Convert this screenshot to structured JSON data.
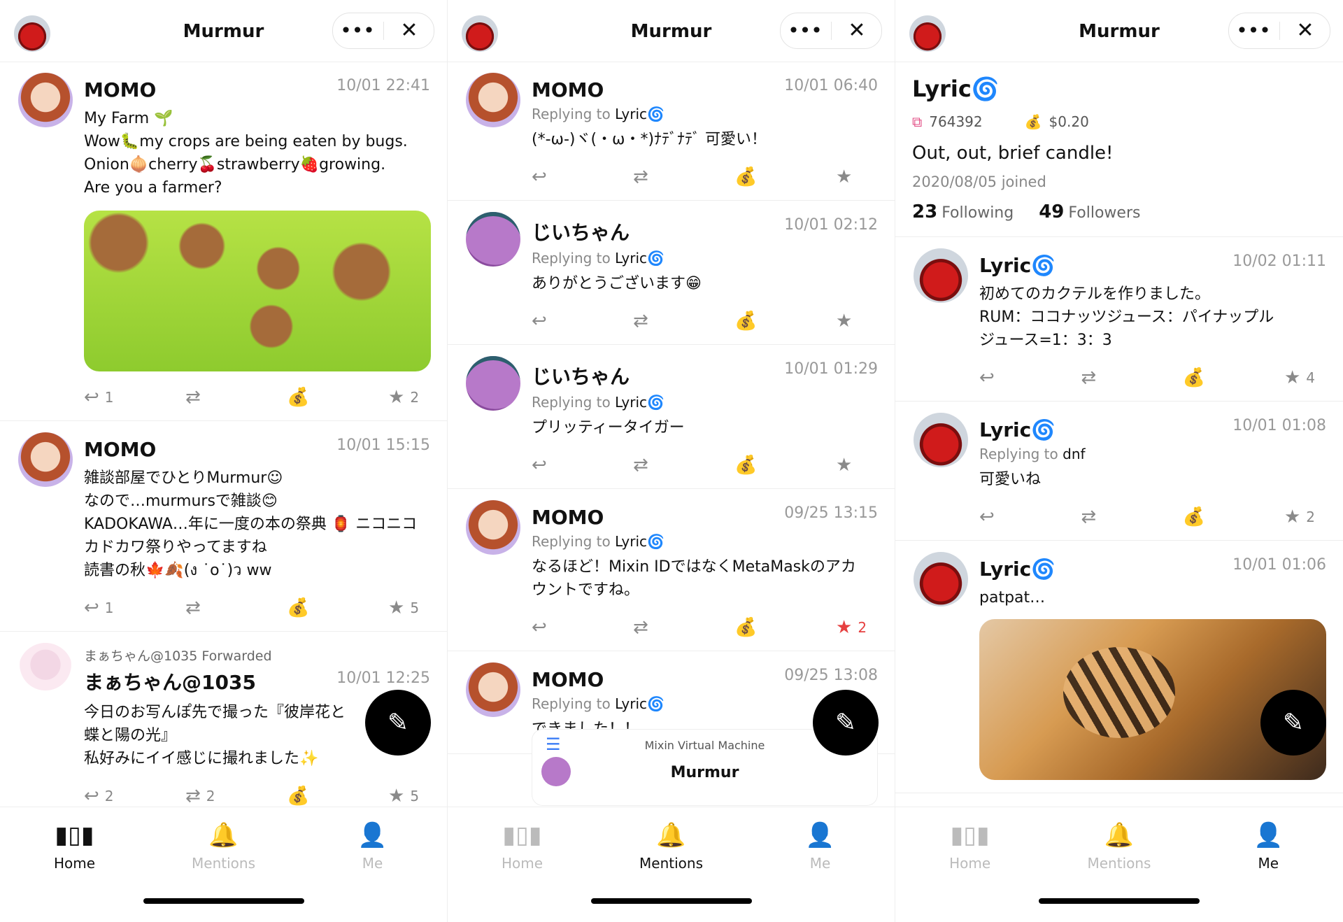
{
  "app": {
    "title": "Murmur",
    "more_icon": "•••",
    "close_icon": "✕",
    "nav": {
      "home": "Home",
      "mentions": "Mentions",
      "me": "Me"
    }
  },
  "home_feed": {
    "posts": [
      {
        "author": "MOMO",
        "time": "10/01 22:41",
        "text": "My Farm 🌱\nWow🐛my crops are being eaten by bugs.\nOnion🧅cherry🍒strawberry🍓growing.\nAre you a farmer?",
        "reply_count": "1",
        "repost_count": "",
        "star_count": "2"
      },
      {
        "author": "MOMO",
        "time": "10/01 15:15",
        "text": "雑談部屋でひとりMurmur☺\nなので…murmursで雑談😊\nKADOKAWA…年に一度の本の祭典 🏮 ニコニコ\nカドカワ祭りやってますね\n読書の秋🍁🍂(ง ˙o˙)ว ww",
        "reply_count": "1",
        "repost_count": "",
        "star_count": "5"
      },
      {
        "forwarded_by": "まぁちゃん@1035 Forwarded",
        "author": "まぁちゃん@1035",
        "time": "10/01 12:25",
        "text": "今日のお写んぽ先で撮った『彼岸花と\n蝶と陽の光』\n私好みにイイ感じに撮れました✨",
        "reply_count": "2",
        "repost_count": "2",
        "star_count": "5"
      }
    ]
  },
  "mentions_feed": {
    "posts": [
      {
        "author": "MOMO",
        "time": "10/01 06:40",
        "reply_prefix": "Replying to",
        "reply_to": "Lyric🌀",
        "text": "(*-ω-)ヾ(・ω・*)ﾅﾃﾞﾅﾃﾞ 可愛い！",
        "star_count": ""
      },
      {
        "author": "じいちゃん",
        "time": "10/01 02:12",
        "reply_prefix": "Replying to",
        "reply_to": "Lyric🌀",
        "text": "ありがとうございます😁",
        "star_count": ""
      },
      {
        "author": "じいちゃん",
        "time": "10/01 01:29",
        "reply_prefix": "Replying to",
        "reply_to": "Lyric🌀",
        "text": "プリッティータイガー",
        "star_count": ""
      },
      {
        "author": "MOMO",
        "time": "09/25 13:15",
        "reply_prefix": "Replying to",
        "reply_to": "Lyric🌀",
        "text": "なるほど！Mixin IDではなくMetaMaskのアカ\nウントですね。",
        "star_count": "2"
      },
      {
        "author": "MOMO",
        "time": "09/25 13:08",
        "reply_prefix": "Replying to",
        "reply_to": "Lyric🌀",
        "text": "できました！！",
        "star_count": ""
      }
    ],
    "mini_card": {
      "subtitle": "Mixin Virtual Machine",
      "title": "Murmur"
    }
  },
  "profile": {
    "name": "Lyric🌀",
    "id": "764392",
    "balance": "$0.20",
    "bio": "Out, out, brief candle!",
    "joined": "2020/08/05 joined",
    "following_count": "23",
    "following_label": "Following",
    "followers_count": "49",
    "followers_label": "Followers",
    "posts": [
      {
        "author": "Lyric🌀",
        "time": "10/02 01:11",
        "text": "初めてのカクテルを作りました。\nRUM：ココナッツジュース：パイナップル\nジュース=1：3：3",
        "star_count": "4"
      },
      {
        "author": "Lyric🌀",
        "time": "10/01 01:08",
        "reply_prefix": "Replying to",
        "reply_to": "dnf",
        "text": "可愛いね",
        "star_count": "2"
      },
      {
        "author": "Lyric🌀",
        "time": "10/01 01:06",
        "text": "patpat…",
        "star_count": ""
      }
    ]
  }
}
